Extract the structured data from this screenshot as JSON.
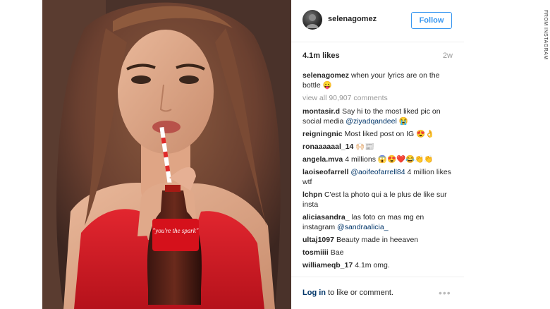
{
  "post": {
    "username": "selenagomez",
    "follow_label": "Follow",
    "likes": "4.1m likes",
    "time": "2w",
    "caption": {
      "username": "selenagomez",
      "text": "when your lyrics are on the bottle 😛"
    },
    "view_all": "view all 90,907 comments",
    "comments": [
      {
        "username": "montasir.d",
        "text": "Say hi to the most liked pic on social media ",
        "mention": "@ziyadqandeel",
        "after": " 😭"
      },
      {
        "username": "reigningnic",
        "text": "Most liked post on IG 😍👌",
        "mention": "",
        "after": ""
      },
      {
        "username": "ronaaaaaal_14",
        "text": "🙌🏻📰",
        "mention": "",
        "after": ""
      },
      {
        "username": "angela.mva",
        "text": "4 millions 😱😍❤️😂👏👏",
        "mention": "",
        "after": ""
      },
      {
        "username": "laoiseofarrell",
        "text": "",
        "mention": "@aoifeofarrell84",
        "after": " 4 million likes wtf"
      },
      {
        "username": "lchpn",
        "text": "C'est la photo qui a le plus de like sur insta",
        "mention": "",
        "after": ""
      },
      {
        "username": "aliciasandra_",
        "text": "las foto cn mas mg en instagram ",
        "mention": "@sandraalicia_",
        "after": ""
      },
      {
        "username": "ultaj1097",
        "text": "Beauty made in heeaven",
        "mention": "",
        "after": ""
      },
      {
        "username": "tosmiiii",
        "text": "Bae",
        "mention": "",
        "after": ""
      },
      {
        "username": "williameqb_17",
        "text": "4.1m omg.",
        "mention": "",
        "after": ""
      }
    ]
  },
  "footer": {
    "login": "Log in",
    "rest": " to like or comment.",
    "more": "•••"
  },
  "credit": "FROM INSTAGRAM",
  "bottle_text": "\"you're the spark\"",
  "icons": {
    "avatar": "profile-photo",
    "more": "more-options-icon"
  },
  "colors": {
    "accent": "#3897f0",
    "link": "#003569",
    "muted": "#999999"
  }
}
